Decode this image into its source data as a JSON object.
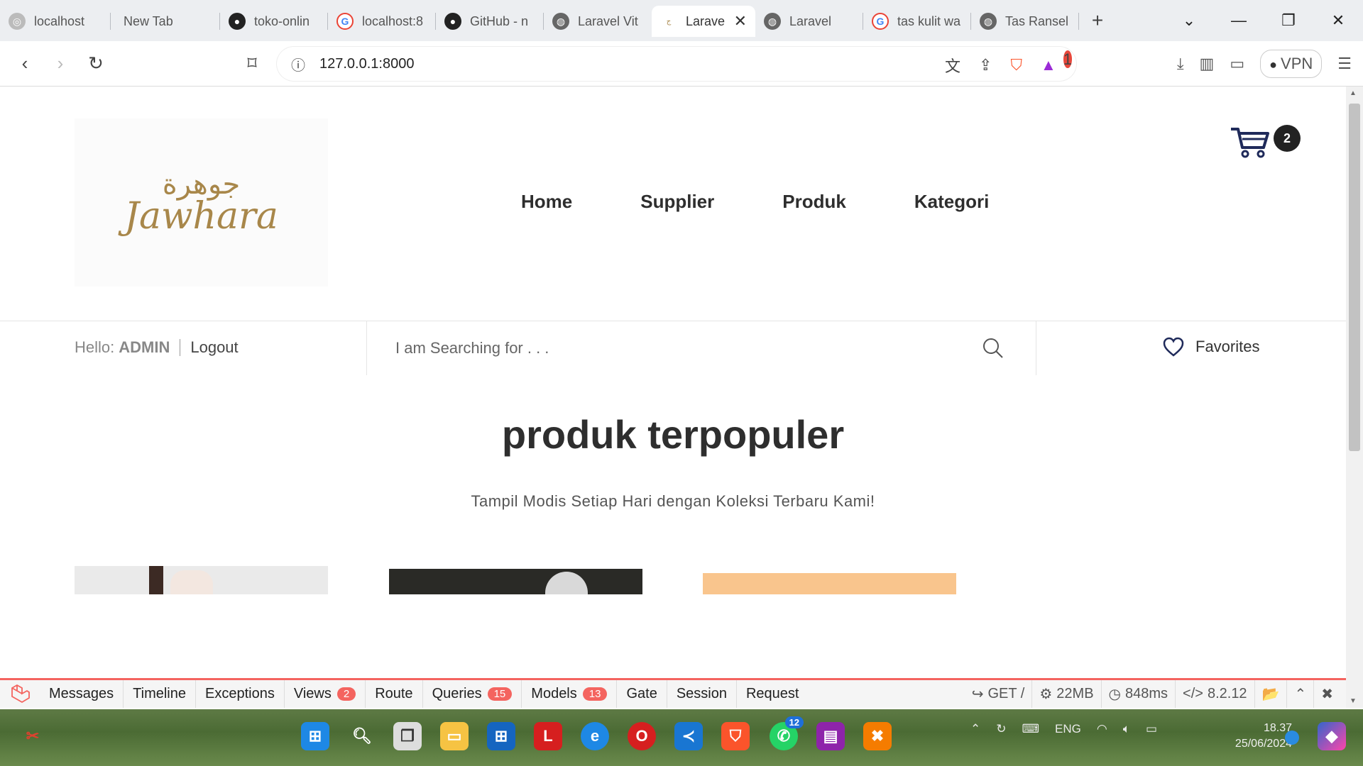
{
  "browser": {
    "tabs": [
      {
        "label": "localhost",
        "icon": "app-icon"
      },
      {
        "label": "New Tab",
        "icon": ""
      },
      {
        "label": "toko-onlin",
        "icon": "github-icon"
      },
      {
        "label": "localhost:8",
        "icon": "google-icon"
      },
      {
        "label": "GitHub - n",
        "icon": "github-icon"
      },
      {
        "label": "Laravel Vit",
        "icon": "globe-icon"
      },
      {
        "label": "Larave",
        "icon": "jawhara-icon"
      },
      {
        "label": "Laravel",
        "icon": "globe-icon"
      },
      {
        "label": "tas kulit wa",
        "icon": "google-icon"
      },
      {
        "label": "Tas Ransel",
        "icon": "globe-icon"
      }
    ],
    "url": "127.0.0.1:8000",
    "vpn_label": "VPN",
    "rewards_badge": "1"
  },
  "site": {
    "logo_arabic": "جوهرة",
    "logo_latin": "Jawhara",
    "nav": [
      "Home",
      "Supplier",
      "Produk",
      "Kategori"
    ],
    "cart_count": "2",
    "hello_label": "Hello:",
    "user_name": "ADMIN",
    "logout_label": "Logout",
    "search_placeholder": "I am Searching for . . .",
    "favorites_label": "Favorites",
    "section_title": "produk terpopuler",
    "section_subtitle": "Tampil Modis Setiap Hari dengan Koleksi Terbaru Kami!"
  },
  "debugbar": {
    "tabs": [
      {
        "label": "Messages",
        "badge": ""
      },
      {
        "label": "Timeline",
        "badge": ""
      },
      {
        "label": "Exceptions",
        "badge": ""
      },
      {
        "label": "Views",
        "badge": "2"
      },
      {
        "label": "Route",
        "badge": ""
      },
      {
        "label": "Queries",
        "badge": "15"
      },
      {
        "label": "Models",
        "badge": "13"
      },
      {
        "label": "Gate",
        "badge": ""
      },
      {
        "label": "Session",
        "badge": ""
      },
      {
        "label": "Request",
        "badge": ""
      }
    ],
    "method": "GET /",
    "memory": "22MB",
    "time": "848ms",
    "php_version": "8.2.12"
  },
  "taskbar": {
    "whatsapp_badge": "12",
    "language": "ENG",
    "time": "18.37",
    "date": "25/06/2024"
  },
  "colors": {
    "accent_red": "#f4645f",
    "logo_gold": "#a8874a",
    "card3_peach": "#f9c58d"
  }
}
